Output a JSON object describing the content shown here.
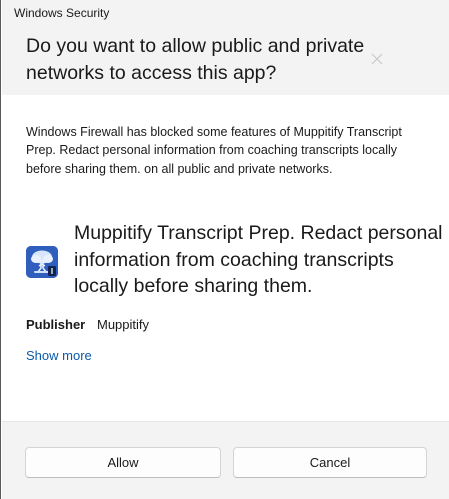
{
  "window": {
    "title": "Windows Security"
  },
  "dialog": {
    "heading": "Do you want to allow public and private networks to access this app?",
    "description": "Windows Firewall has blocked some features of Muppitify Transcript Prep. Redact personal information from coaching transcripts locally before sharing them. on all public and private networks.",
    "app_name": "Muppitify Transcript Prep. Redact personal information from coaching transcripts locally before sharing them.",
    "app_icon": "tree-app-icon",
    "publisher_label": "Publisher",
    "publisher_value": "Muppitify",
    "show_more": "Show more"
  },
  "buttons": {
    "allow": "Allow",
    "cancel": "Cancel"
  },
  "colors": {
    "header_bg": "#f3f3f3",
    "footer_bg": "#f3f3f3",
    "body_bg": "#ffffff",
    "link": "#0a5aa8",
    "app_icon_bg": "#2f5ebd"
  }
}
